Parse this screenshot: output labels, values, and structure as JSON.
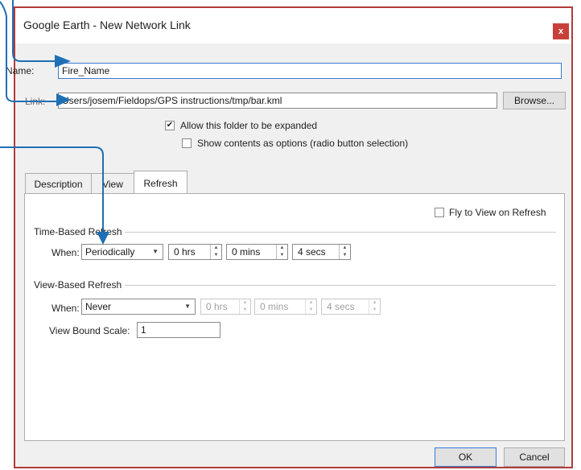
{
  "window": {
    "title": "Google Earth - New Network Link",
    "close_glyph": "x"
  },
  "form": {
    "name_label": "Name:",
    "name_value": "Fire_Name",
    "link_label": "Link:",
    "link_value": "Users/josem/Fieldops/GPS instructions/tmp/bar.kml",
    "browse_label": "Browse...",
    "allow_expand_label": "Allow this folder to be expanded",
    "allow_expand_checked": "✔",
    "show_contents_label": "Show contents as options (radio button selection)"
  },
  "tabs": [
    {
      "label": "Description"
    },
    {
      "label": "View"
    },
    {
      "label": "Refresh"
    }
  ],
  "refresh": {
    "fly_to_view_label": "Fly to View on Refresh",
    "time_group": "Time-Based Refresh",
    "time_when_label": "When:",
    "time_when_value": "Periodically",
    "hrs": "0 hrs",
    "mins": "0 mins",
    "secs": "4 secs",
    "view_group": "View-Based Refresh",
    "view_when_label": "When:",
    "view_when_value": "Never",
    "view_hrs": "0 hrs",
    "view_mins": "0 mins",
    "view_secs": "4 secs",
    "bound_scale_label": "View Bound Scale:",
    "bound_scale_value": "1"
  },
  "footer": {
    "ok_label": "OK",
    "cancel_label": "Cancel"
  },
  "colors": {
    "accent": "#1f6fb4",
    "close": "#c9403a",
    "frame": "#b33a3a"
  },
  "icons": {
    "close": "close-icon",
    "dropdown": "chevron-down-icon",
    "spin": "spin-arrows-icon",
    "check": "checkmark-icon"
  }
}
